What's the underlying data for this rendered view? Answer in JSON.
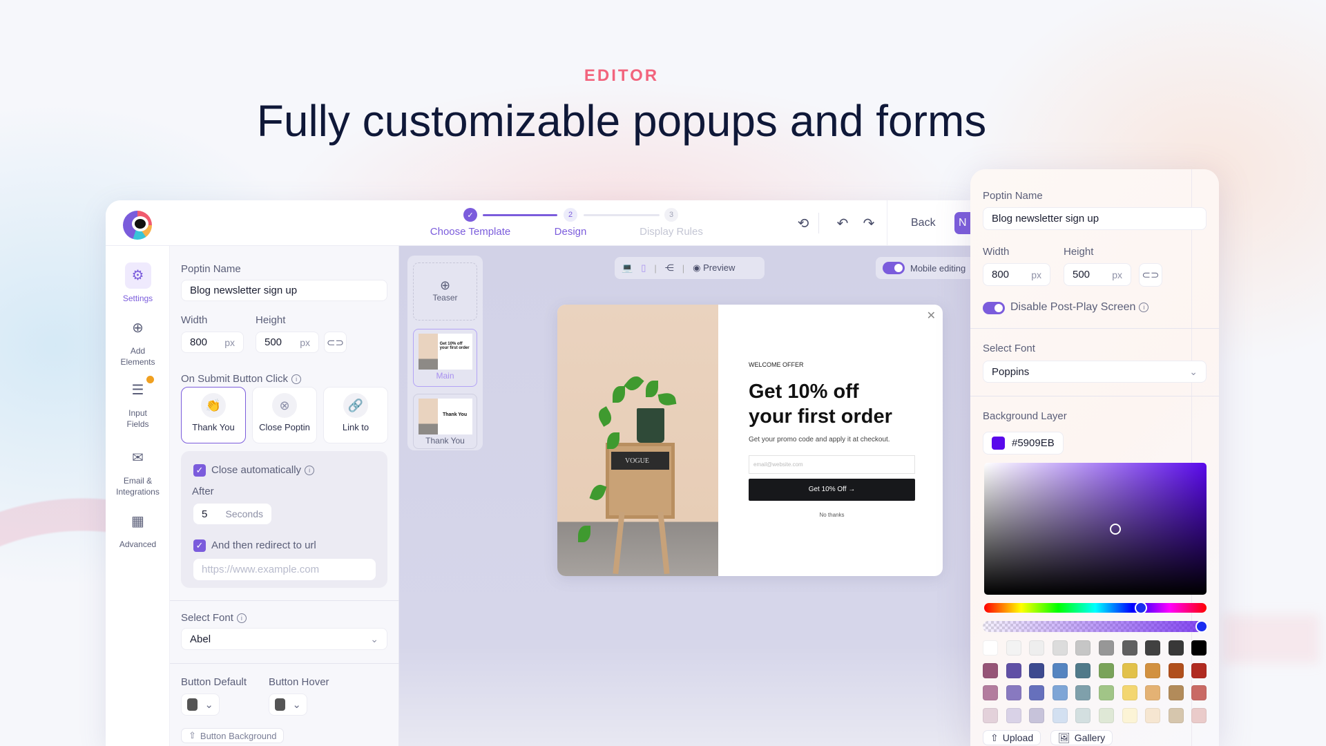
{
  "hero": {
    "eyebrow": "EDITOR",
    "title": "Fully customizable popups and forms"
  },
  "header": {
    "steps": [
      {
        "num": "✓",
        "label": "Choose Template",
        "state": "done"
      },
      {
        "num": "2",
        "label": "Design",
        "state": "active"
      },
      {
        "num": "3",
        "label": "Display Rules",
        "state": "pending"
      }
    ],
    "back_label": "Back",
    "next_label": "N"
  },
  "sidebar": {
    "items": [
      {
        "label": "Settings",
        "icon": "gear-icon",
        "active": true
      },
      {
        "label": "Add Elements",
        "icon": "plus-circle-icon"
      },
      {
        "label": "Input Fields",
        "icon": "input-fields-icon",
        "badge": true
      },
      {
        "label": "Email & Integrations",
        "icon": "mail-icon"
      },
      {
        "label": "Advanced",
        "icon": "grid-icon"
      }
    ]
  },
  "settings": {
    "name_label": "Poptin Name",
    "name_value": "Blog newsletter sign up",
    "width_label": "Width",
    "width_value": "800",
    "height_label": "Height",
    "height_value": "500",
    "unit": "px",
    "submit_label": "On Submit Button Click",
    "submit_options": [
      {
        "label": "Thank You",
        "icon": "clapping-hands-icon",
        "selected": true
      },
      {
        "label": "Close Poptin",
        "icon": "close-circle-icon"
      },
      {
        "label": "Link to",
        "icon": "link-icon"
      }
    ],
    "close_auto_label": "Close automatically",
    "close_auto_checked": true,
    "after_label": "After",
    "after_value": "5",
    "after_unit": "Seconds",
    "redirect_label": "And then redirect to url",
    "redirect_checked": true,
    "url_placeholder": "https://www.example.com",
    "font_label": "Select Font",
    "font_value": "Abel",
    "btn_default_label": "Button Default",
    "btn_hover_label": "Button Hover",
    "btn_default_color": "#555555",
    "btn_hover_color": "#555555",
    "btn_bg_label": "Button Background"
  },
  "canvas": {
    "preview_label": "Preview",
    "mobile_label": "Mobile editing",
    "mobile_on": true,
    "thumbs": [
      {
        "label": "Teaser"
      },
      {
        "label": "Main",
        "selected": true
      },
      {
        "label": "Thank You",
        "inner": "Thank You"
      }
    ],
    "popup": {
      "eyebrow": "WELCOME OFFER",
      "title1": "Get 10% off",
      "title2": "your first order",
      "subtitle": "Get your promo code and apply it at checkout.",
      "email_placeholder": "email@website.com",
      "button": "Get 10% Off →",
      "no_thanks": "No thanks",
      "book": "VOGUE"
    }
  },
  "right_panel": {
    "name_label": "Poptin Name",
    "name_value": "Blog newsletter sign up",
    "width_label": "Width",
    "width_value": "800",
    "height_label": "Height",
    "height_value": "500",
    "unit": "px",
    "toggle_label": "Disable Post-Play Screen",
    "toggle_on": true,
    "font_label": "Select Font",
    "font_value": "Poppins",
    "bg_label": "Background Layer",
    "bg_hex": "#5909EB",
    "hue_value": "262°",
    "alpha_percent": 100,
    "swatches": [
      [
        "#ffffff",
        "#f3f3f3",
        "#eeeeee",
        "#dcdcdc",
        "#c6c6c6",
        "#979797",
        "#606060",
        "#414141",
        "#383838",
        "#000000"
      ],
      [
        "#965577",
        "#6050a5",
        "#3d4a8f",
        "#5584c0",
        "#517a8a",
        "#7aa35a",
        "#e2c14a",
        "#d29140",
        "#b04f1c",
        "#b02a20"
      ],
      [
        "#b37c9e",
        "#8879c0",
        "#6670bc",
        "#7ea5d6",
        "#7fa0ab",
        "#a1c587",
        "#f3d671",
        "#e4b274",
        "#b28b5a",
        "#c96a65"
      ],
      [
        "#e3d1da",
        "#d9d2e7",
        "#c7c3da",
        "#d3e0f1",
        "#d3dfe0",
        "#dfe8d6",
        "#fcf4d6",
        "#f6e6d1",
        "#d6c6ad",
        "#eacbca"
      ]
    ],
    "upload_label": "Upload",
    "gallery_label": "Gallery"
  },
  "colors": {
    "accent": "#7B5CDC",
    "eyebrow": "#F2647D"
  }
}
